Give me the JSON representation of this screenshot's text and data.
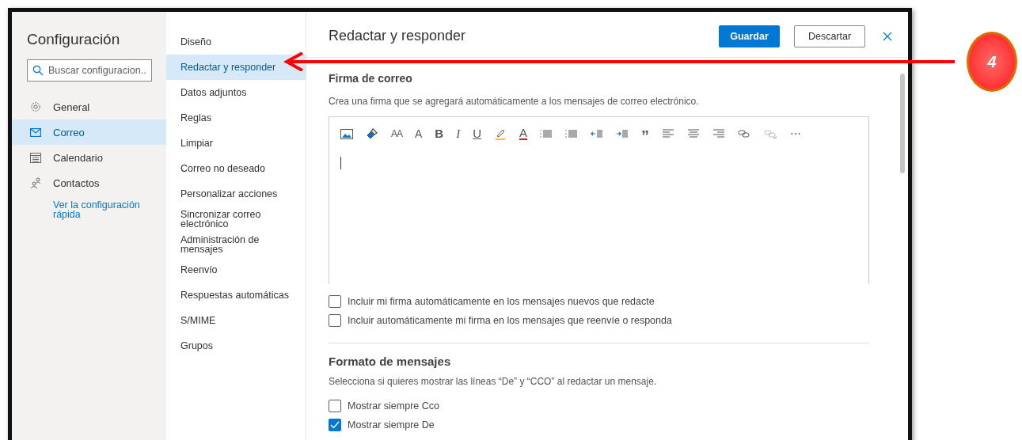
{
  "settings": {
    "title": "Configuración",
    "search": {
      "placeholder": "Buscar configuracion..."
    },
    "categories": [
      {
        "label": "General",
        "selected": false
      },
      {
        "label": "Correo",
        "selected": true
      },
      {
        "label": "Calendario",
        "selected": false
      },
      {
        "label": "Contactos",
        "selected": false
      }
    ],
    "quick_link": "Ver la configuración rápida"
  },
  "subnav": [
    {
      "label": "Diseño",
      "selected": false
    },
    {
      "label": "Redactar y responder",
      "selected": true
    },
    {
      "label": "Datos adjuntos",
      "selected": false
    },
    {
      "label": "Reglas",
      "selected": false
    },
    {
      "label": "Limpiar",
      "selected": false
    },
    {
      "label": "Correo no deseado",
      "selected": false
    },
    {
      "label": "Personalizar acciones",
      "selected": false
    },
    {
      "label": "Sincronizar correo electrónico",
      "selected": false
    },
    {
      "label": "Administración de mensajes",
      "selected": false
    },
    {
      "label": "Reenvío",
      "selected": false
    },
    {
      "label": "Respuestas automáticas",
      "selected": false
    },
    {
      "label": "S/MIME",
      "selected": false
    },
    {
      "label": "Grupos",
      "selected": false
    }
  ],
  "panel": {
    "title": "Redactar y responder",
    "save_button": "Guardar",
    "discard_button": "Descartar",
    "signature": {
      "heading": "Firma de correo",
      "description": "Crea una firma que se agregará automáticamente a los mensajes de correo electrónico.",
      "toolbar": [
        {
          "kind": "image"
        },
        {
          "kind": "brush"
        },
        {
          "kind": "fontsize",
          "text": "AA"
        },
        {
          "kind": "grow",
          "text": "A"
        },
        {
          "kind": "bold",
          "text": "B"
        },
        {
          "kind": "italic",
          "text": "I"
        },
        {
          "kind": "underline",
          "text": "U"
        },
        {
          "kind": "highlight"
        },
        {
          "kind": "fontcolor",
          "text": "A"
        },
        {
          "kind": "bullets"
        },
        {
          "kind": "numbering"
        },
        {
          "kind": "outdent"
        },
        {
          "kind": "indent"
        },
        {
          "kind": "quote",
          "text": "”"
        },
        {
          "kind": "left"
        },
        {
          "kind": "center"
        },
        {
          "kind": "right"
        },
        {
          "kind": "link",
          "disabled": false
        },
        {
          "kind": "unlink",
          "disabled": true
        },
        {
          "kind": "more",
          "text": "⋯"
        }
      ],
      "options": [
        {
          "label": "Incluir mi firma automáticamente en los mensajes nuevos que redacte",
          "checked": false
        },
        {
          "label": "Incluir automáticamente mi firma en los mensajes que reenvíe o responda",
          "checked": false
        }
      ]
    },
    "format": {
      "heading": "Formato de mensajes",
      "description": "Selecciona si quieres mostrar las líneas “De” y “CCO” al redactar un mensaje.",
      "options": [
        {
          "label": "Mostrar siempre Cco",
          "checked": false
        },
        {
          "label": "Mostrar siempre De",
          "checked": true
        }
      ]
    }
  },
  "annotation": {
    "step": "4"
  }
}
